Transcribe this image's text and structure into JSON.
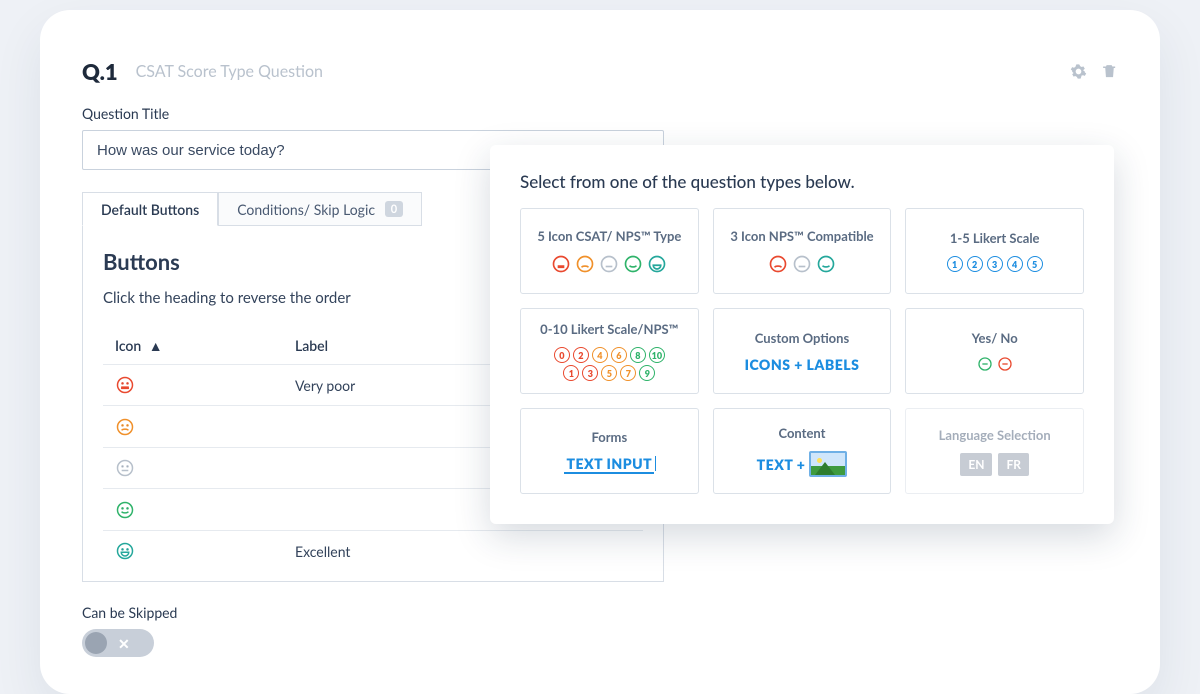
{
  "question": {
    "number": "Q.1",
    "type_label": "CSAT Score Type Question",
    "title_label": "Question Title",
    "title_value": "How was our service today?"
  },
  "tabs": {
    "default_buttons": "Default Buttons",
    "conditions": "Conditions/ Skip Logic",
    "conditions_count": "0"
  },
  "panel": {
    "heading": "Buttons",
    "hint": "Click the heading to reverse the order",
    "col_icon": "Icon",
    "col_label": "Label",
    "rows": [
      {
        "label": "Very poor"
      },
      {
        "label": ""
      },
      {
        "label": ""
      },
      {
        "label": ""
      },
      {
        "label": "Excellent"
      }
    ]
  },
  "skip": {
    "label": "Can be Skipped",
    "state": "off"
  },
  "chooser": {
    "title": "Select from one of the question types below.",
    "options": {
      "csat5": "5 Icon CSAT/ NPS™ Type",
      "nps3": "3 Icon NPS™ Compatible",
      "likert5": "1-5 Likert Scale",
      "likert10": "0-10 Likert Scale/NPS™",
      "custom": "Custom Options",
      "custom_gfx": "ICONS + LABELS",
      "yesno": "Yes/ No",
      "forms": "Forms",
      "forms_gfx": "TEXT INPUT",
      "content": "Content",
      "content_gfx": "TEXT +",
      "lang": "Language Selection",
      "lang_a": "EN",
      "lang_b": "FR"
    }
  },
  "colors": {
    "red": "#e9492f",
    "orange": "#f0902a",
    "grey": "#b7c0cb",
    "green": "#2fb36a",
    "teal": "#24a79b",
    "blue": "#1c8de0"
  }
}
